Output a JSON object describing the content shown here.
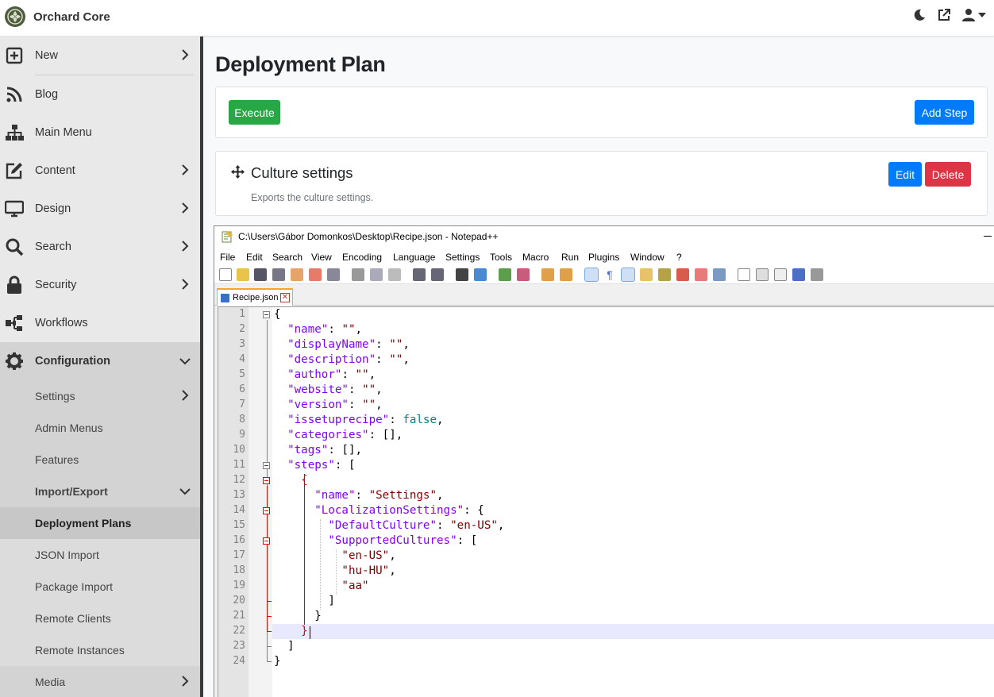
{
  "app": {
    "brand": "Orchard Core"
  },
  "sidebar": {
    "items": [
      {
        "label": "New",
        "icon": "plus-square-icon"
      },
      {
        "label": "Blog",
        "icon": "rss-icon"
      },
      {
        "label": "Main Menu",
        "icon": "sitemap-icon"
      },
      {
        "label": "Content",
        "icon": "edit-icon"
      },
      {
        "label": "Design",
        "icon": "monitor-icon"
      },
      {
        "label": "Search",
        "icon": "search-icon"
      },
      {
        "label": "Security",
        "icon": "lock-icon"
      },
      {
        "label": "Workflows",
        "icon": "workflow-icon"
      },
      {
        "label": "Configuration",
        "icon": "gear-icon"
      }
    ],
    "configuration": {
      "settings": "Settings",
      "admin_menus": "Admin Menus",
      "features": "Features",
      "import_export": "Import/Export",
      "deployment_plans": "Deployment Plans",
      "json_import": "JSON Import",
      "package_import": "Package Import",
      "remote_clients": "Remote Clients",
      "remote_instances": "Remote Instances"
    },
    "media": "Media"
  },
  "main": {
    "title": "Deployment Plan",
    "execute_label": "Execute",
    "add_step_label": "Add Step",
    "step": {
      "title": "Culture settings",
      "description": "Exports the culture settings.",
      "edit_label": "Edit",
      "delete_label": "Delete"
    }
  },
  "colors": {
    "execute": "#28a745",
    "primary": "#007bff",
    "danger": "#dc3545",
    "json_key": "#8000ff",
    "json_string": "#800000",
    "json_bool": "#008080"
  },
  "npp": {
    "title": "C:\\Users\\Gábor Domonkos\\Desktop\\Recipe.json - Notepad++",
    "menu": [
      "File",
      "Edit",
      "Search",
      "View",
      "Encoding",
      "Language",
      "Settings",
      "Tools",
      "Macro",
      "Run",
      "Plugins",
      "Window",
      "?"
    ],
    "tab": "Recipe.json",
    "lines": [
      "{",
      "  \"name\": \"\",",
      "  \"displayName\": \"\",",
      "  \"description\": \"\",",
      "  \"author\": \"\",",
      "  \"website\": \"\",",
      "  \"version\": \"\",",
      "  \"issetuprecipe\": false,",
      "  \"categories\": [],",
      "  \"tags\": [],",
      "  \"steps\": [",
      "    {",
      "      \"name\": \"Settings\",",
      "      \"LocalizationSettings\": {",
      "        \"DefaultCulture\": \"en-US\",",
      "        \"SupportedCultures\": [",
      "          \"en-US\",",
      "          \"hu-HU\",",
      "          \"aa\"",
      "        ]",
      "      }",
      "    }",
      "  ]",
      "}"
    ]
  }
}
